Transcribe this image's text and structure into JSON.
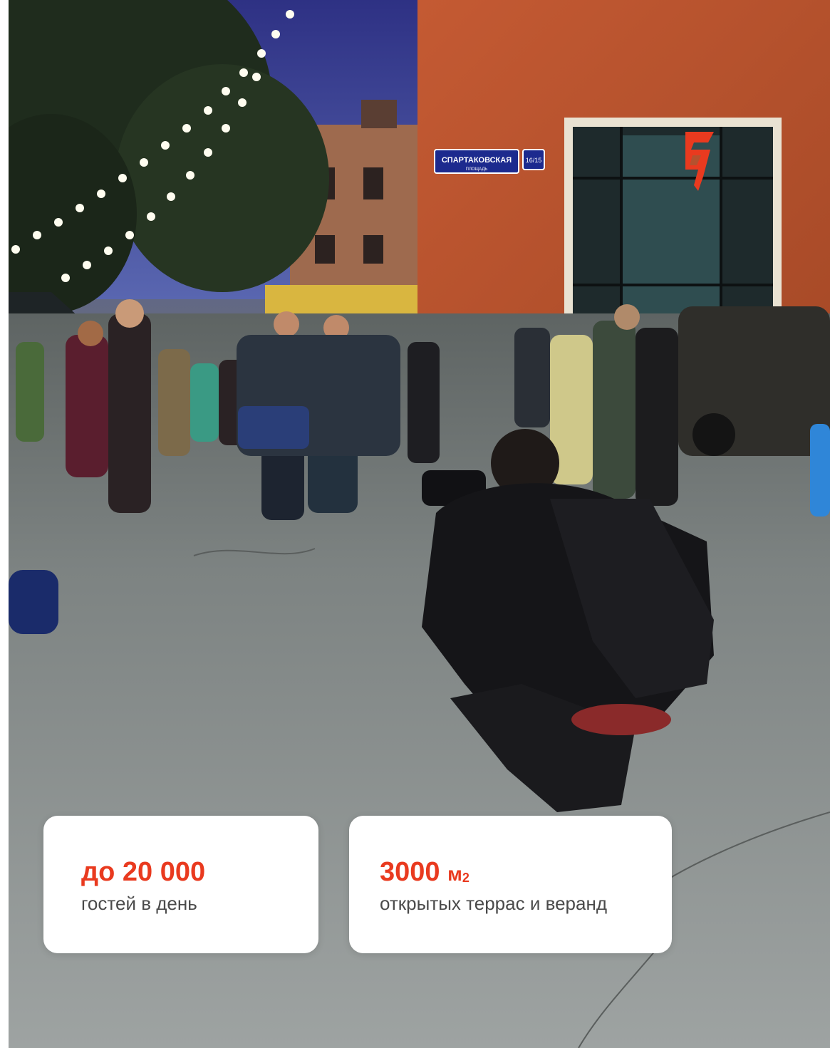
{
  "photo": {
    "street_sign": {
      "name": "СПАРТАКОВСКАЯ",
      "sub": "ПЛОЩАДЬ",
      "number": "16/15"
    },
    "logo_icon": "brand-logo-icon",
    "colors": {
      "brand_accent": "#e93a1f",
      "brick": "#b5512e",
      "sky": "#3b3f8a",
      "asphalt": "#8e9392"
    }
  },
  "stats": [
    {
      "value": "до 20 000",
      "unit": "",
      "superscript": "",
      "label": "гостей в день"
    },
    {
      "value": "3000",
      "unit": "м",
      "superscript": "2",
      "label": "открытых террас и веранд"
    }
  ]
}
